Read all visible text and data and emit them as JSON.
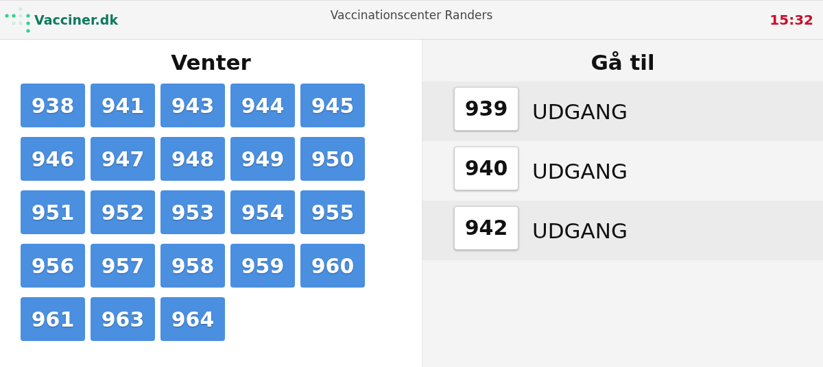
{
  "header": {
    "logo_text": "Vacciner.dk",
    "title": "Vaccinationscenter Randers",
    "clock": "15:32"
  },
  "waiting": {
    "title": "Venter",
    "numbers": [
      "938",
      "941",
      "943",
      "944",
      "945",
      "946",
      "947",
      "948",
      "949",
      "950",
      "951",
      "952",
      "953",
      "954",
      "955",
      "956",
      "957",
      "958",
      "959",
      "960",
      "961",
      "963",
      "964"
    ]
  },
  "called": {
    "title": "Gå til",
    "rows": [
      {
        "number": "939",
        "destination": "UDGANG"
      },
      {
        "number": "940",
        "destination": "UDGANG"
      },
      {
        "number": "942",
        "destination": "UDGANG"
      }
    ]
  }
}
